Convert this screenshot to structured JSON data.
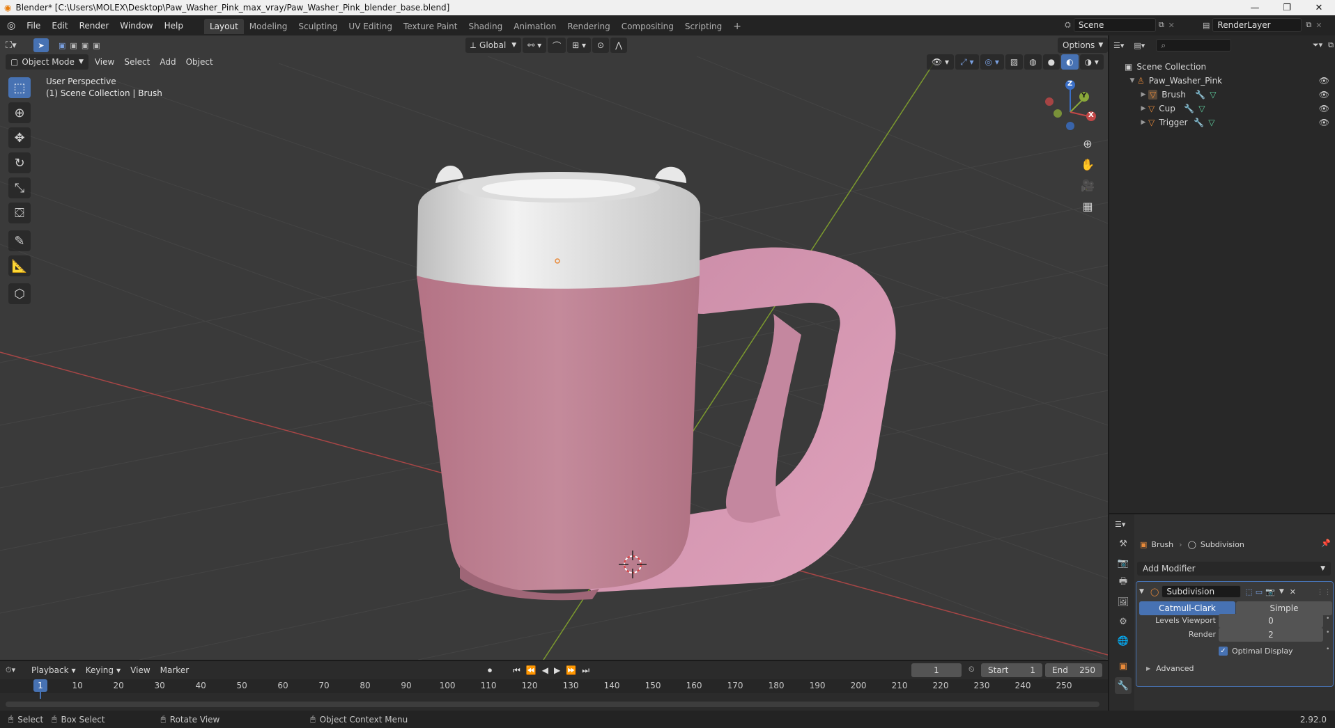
{
  "title_bar": {
    "text": "Blender* [C:\\Users\\MOLEX\\Desktop\\Paw_Washer_Pink_max_vray/Paw_Washer_Pink_blender_base.blend]"
  },
  "menu": [
    "File",
    "Edit",
    "Render",
    "Window",
    "Help"
  ],
  "workspaces": [
    "Layout",
    "Modeling",
    "Sculpting",
    "UV Editing",
    "Texture Paint",
    "Shading",
    "Animation",
    "Rendering",
    "Compositing",
    "Scripting"
  ],
  "active_workspace": "Layout",
  "scene": {
    "name": "Scene",
    "render_layer": "RenderLayer"
  },
  "viewport": {
    "header": {
      "mode": "Object Mode",
      "menus": [
        "View",
        "Select",
        "Add",
        "Object"
      ],
      "transform_orientation": "Global",
      "options_label": "Options"
    },
    "overlay_text": {
      "perspective": "User Perspective",
      "collection": "(1) Scene Collection | Brush"
    },
    "gizmo": {
      "z": "Z",
      "y": "Y",
      "x": "X"
    }
  },
  "outliner": {
    "root": "Scene Collection",
    "collection": "Paw_Washer_Pink",
    "objects": [
      {
        "name": "Brush"
      },
      {
        "name": "Cup"
      },
      {
        "name": "Trigger"
      }
    ]
  },
  "properties": {
    "breadcrumb_object": "Brush",
    "breadcrumb_modifier": "Subdivision",
    "add_modifier": "Add Modifier",
    "modifier": {
      "name": "Subdivision",
      "type_options": [
        "Catmull-Clark",
        "Simple"
      ],
      "selected_type": "Catmull-Clark",
      "levels_viewport_label": "Levels Viewport",
      "levels_viewport": "0",
      "render_label": "Render",
      "render": "2",
      "optimal_display_label": "Optimal Display",
      "optimal_display": true,
      "advanced_label": "Advanced"
    }
  },
  "timeline": {
    "menus": [
      "Playback",
      "Keying",
      "View",
      "Marker"
    ],
    "current_frame": "1",
    "start_label": "Start",
    "start": "1",
    "end_label": "End",
    "end": "250",
    "ticks": [
      "1",
      "10",
      "20",
      "30",
      "40",
      "50",
      "60",
      "70",
      "80",
      "90",
      "100",
      "110",
      "120",
      "130",
      "140",
      "150",
      "160",
      "170",
      "180",
      "190",
      "200",
      "210",
      "220",
      "230",
      "240",
      "250"
    ]
  },
  "statusbar": {
    "select": "Select",
    "box_select": "Box Select",
    "rotate_view": "Rotate View",
    "context_menu": "Object Context Menu",
    "version": "2.92.0"
  },
  "colors": {
    "accent": "#4772b3",
    "cup_pink": "#c68a9c",
    "handle_pink": "#d99bb6",
    "rim_white": "#e6e6e6",
    "axis_x": "#c24747",
    "axis_y": "#8aa83a",
    "axis_z": "#3a6fc7",
    "object_orange": "#e88a3a"
  }
}
